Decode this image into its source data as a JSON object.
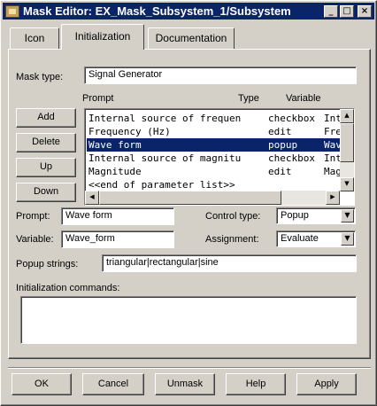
{
  "window": {
    "title": "Mask Editor: EX_Mask_Subsystem_1/Subsystem"
  },
  "tabs": [
    {
      "label": "Icon"
    },
    {
      "label": "Initialization"
    },
    {
      "label": "Documentation"
    }
  ],
  "mask_type": {
    "label": "Mask type:",
    "value": "Signal Generator"
  },
  "param_list": {
    "headers": {
      "prompt": "Prompt",
      "type": "Type",
      "variable": "Variable"
    },
    "rows": [
      {
        "prompt": "Internal source of frequen",
        "type": "checkbox",
        "variable": "Int"
      },
      {
        "prompt": "Frequency (Hz)",
        "type": "edit",
        "variable": "Fre"
      },
      {
        "prompt": "Wave form",
        "type": "popup",
        "variable": "Wav"
      },
      {
        "prompt": "Internal source of magnitu",
        "type": "checkbox",
        "variable": "Int"
      },
      {
        "prompt": "Magnitude",
        "type": "edit",
        "variable": "Mag"
      },
      {
        "prompt": "<<end of parameter list>>",
        "type": "",
        "variable": ""
      }
    ],
    "selected_index": 2
  },
  "side_buttons": {
    "add": "Add",
    "delete": "Delete",
    "up": "Up",
    "down": "Down"
  },
  "prompt": {
    "label": "Prompt:",
    "value": "Wave form"
  },
  "variable": {
    "label": "Variable:",
    "value": "Wave_form"
  },
  "control_type": {
    "label": "Control type:",
    "value": "Popup"
  },
  "assignment": {
    "label": "Assignment:",
    "value": "Evaluate"
  },
  "popup_strings": {
    "label": "Popup strings:",
    "value": "triangular|rectangular|sine"
  },
  "init_commands": {
    "label": "Initialization commands:",
    "value": ""
  },
  "footer": {
    "ok": "OK",
    "cancel": "Cancel",
    "unmask": "Unmask",
    "help": "Help",
    "apply": "Apply"
  },
  "titlebar_buttons": {
    "minimize": "_",
    "maximize": "□",
    "close": "×"
  },
  "colors": {
    "titlebar": "#0a246a",
    "face": "#d4d0c8",
    "selection": "#0a246a"
  }
}
